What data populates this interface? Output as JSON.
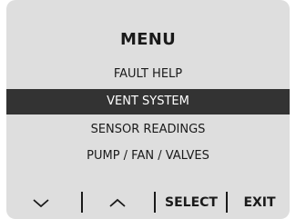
{
  "menu": {
    "title": "MENU",
    "items": [
      {
        "label": "FAULT HELP",
        "selected": false
      },
      {
        "label": "VENT SYSTEM",
        "selected": true
      },
      {
        "label": "SENSOR READINGS",
        "selected": false
      },
      {
        "label": "PUMP / FAN / VALVES",
        "selected": false
      }
    ]
  },
  "softkeys": {
    "down_icon": "chevron-down-icon",
    "up_icon": "chevron-up-icon",
    "select_label": "SELECT",
    "exit_label": "EXIT"
  },
  "colors": {
    "screen_bg": "#dedede",
    "highlight_bg": "#333333",
    "highlight_text": "#ffffff",
    "text": "#1a1a1a"
  }
}
